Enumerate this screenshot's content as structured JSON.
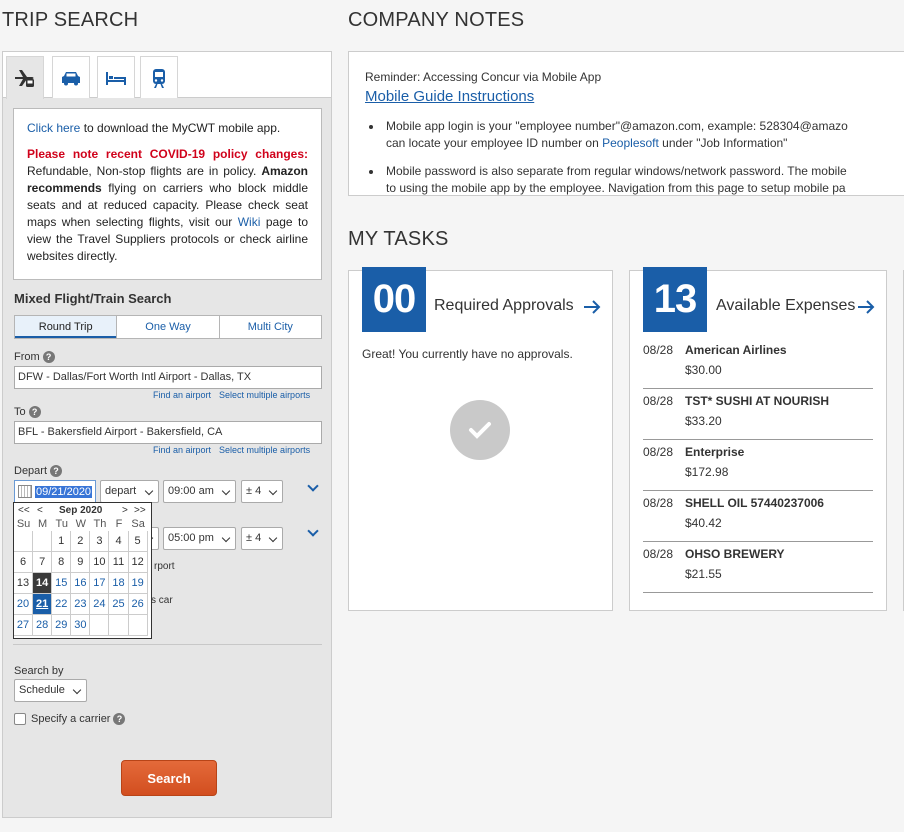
{
  "trip_search": {
    "title": "TRIP SEARCH",
    "mode_tabs": [
      "flight-icon",
      "car-icon",
      "hotel-icon",
      "train-icon"
    ],
    "info": {
      "click_here": "Click here",
      "download_text": " to download the MyCWT mobile app.",
      "covid_heading": "Please note recent COVID-19 policy changes:",
      "covid_text_1": " Refundable, Non-stop flights are in policy. ",
      "amazon_recommends": "Amazon recommends",
      "covid_text_2": " flying on carriers who block middle seats and at reduced capacity. Please check seat maps when selecting flights, visit our ",
      "wiki": "Wiki",
      "covid_text_3": " page to view the Travel Suppliers protocols or check airline websites directly."
    },
    "mixed_title": "Mixed Flight/Train Search",
    "trip_types": [
      "Round Trip",
      "One Way",
      "Multi City"
    ],
    "from_label": "From",
    "from_value": "DFW - Dallas/Fort Worth Intl Airport - Dallas, TX",
    "to_label": "To",
    "to_value": "BFL - Bakersfield Airport - Bakersfield, CA",
    "find_airport": "Find an airport",
    "select_multiple": "Select multiple airports",
    "depart_label": "Depart",
    "depart_date": "09/21/2020",
    "depart_type": "depart",
    "depart_time": "09:00 am",
    "depart_window": "± 4",
    "return_time": "05:00 pm",
    "return_window": "± 4",
    "hidden_airport_text": "rport",
    "hidden_car_text": "s car",
    "calendar": {
      "prev_year": "<<",
      "prev_month": "<",
      "month_year": "Sep 2020",
      "next_month": ">",
      "next_year": ">>",
      "weekdays": [
        "Su",
        "M",
        "Tu",
        "W",
        "Th",
        "F",
        "Sa"
      ],
      "days": [
        "",
        "",
        "1",
        "2",
        "3",
        "4",
        "5",
        "6",
        "7",
        "8",
        "9",
        "10",
        "11",
        "12",
        "13",
        "14",
        "15",
        "16",
        "17",
        "18",
        "19",
        "20",
        "21",
        "22",
        "23",
        "24",
        "25",
        "26",
        "27",
        "28",
        "29",
        "30",
        "",
        "",
        ""
      ],
      "today": "14",
      "selected": "21"
    },
    "search_by_label": "Search by",
    "search_by_value": "Schedule",
    "specify_carrier": "Specify a carrier",
    "search_button": "Search"
  },
  "company_notes": {
    "title": "COMPANY NOTES",
    "reminder": "Reminder: Accessing Concur via Mobile App",
    "guide_link": "Mobile Guide Instructions",
    "bullet1_line1": "Mobile app login is your \"employee number\"@amazon.com, example: 528304@amazo",
    "bullet1_line2_a": "can locate your employee ID number on ",
    "bullet1_line2_link": "Peoplesoft",
    "bullet1_line2_b": " under \"Job Information\"",
    "bullet2_line1": "Mobile password is also separate from regular windows/network password. The mobile",
    "bullet2_line2": "to using the mobile app by the employee. Navigation from this page to setup mobile pa"
  },
  "my_tasks": {
    "title": "MY TASKS",
    "approvals": {
      "count": "00",
      "label": "Required Approvals",
      "empty_text": "Great! You currently have no approvals."
    },
    "expenses": {
      "count": "13",
      "label": "Available Expenses",
      "items": [
        {
          "date": "08/28",
          "vendor": "American Airlines",
          "amount": "$30.00"
        },
        {
          "date": "08/28",
          "vendor": "TST* SUSHI AT NOURISH",
          "amount": "$33.20"
        },
        {
          "date": "08/28",
          "vendor": "Enterprise",
          "amount": "$172.98"
        },
        {
          "date": "08/28",
          "vendor": "SHELL OIL 57440237006",
          "amount": "$40.42"
        },
        {
          "date": "08/28",
          "vendor": "OHSO BREWERY",
          "amount": "$21.55"
        }
      ]
    }
  },
  "colors": {
    "accent_blue": "#1a5ea8",
    "search_orange": "#d9572a",
    "covid_red": "#d0021b"
  }
}
